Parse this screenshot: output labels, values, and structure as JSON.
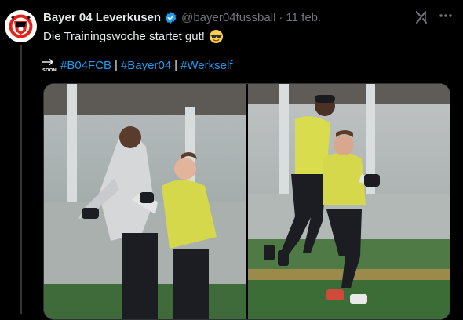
{
  "tweet": {
    "author_name": "Bayer 04 Leverkusen",
    "handle": "@bayer04fussball",
    "separator": "·",
    "date": "11 feb.",
    "text": "Die Trainingswoche startet gut!",
    "hashtags": [
      "#B04FCB",
      "#Bayer04",
      "#Werkself"
    ],
    "hashtag_separator": "|"
  },
  "icons": {
    "verified": "verified-badge-icon",
    "grok": "grok-icon",
    "more": "more-options-icon",
    "soon": "soon-arrow-icon",
    "emoji": "sunglasses-emoji-icon"
  },
  "colors": {
    "background": "#000000",
    "text": "#e7e9ea",
    "secondary": "#71767b",
    "link": "#1d9bf0",
    "verified": "#1d9bf0"
  },
  "media": {
    "photos": [
      "training-photo-1",
      "training-photo-2"
    ]
  }
}
